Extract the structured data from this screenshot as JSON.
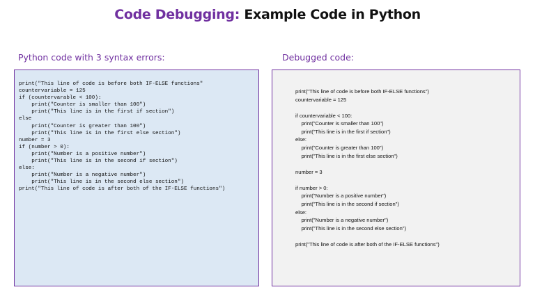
{
  "header": {
    "title_accent": "Code Debugging:",
    "title_rest": " Example Code in Python"
  },
  "left_pane": {
    "label": "Python code with 3 syntax errors:",
    "code": "print(\"This line of code is before both IF-ELSE functions\"\ncountervariable = 125\nif (countervarable < 100):\n    print(\"Counter is smaller than 100\")\n    print(\"This line is in the first if section\")\nelse\n    print(\"Counter is greater than 100\")\n    print(\"This line is in the first else section\")\nnumber = 3\nif (number > 0):\n    print(\"Number is a positive number\")\n    print(\"This line is in the second if section\")\nelse:\n    print(\"Number is a negative number\")\n    print(\"This line is in the second else section\")\nprint(\"This line of code is after both of the IF-ELSE functions\")"
  },
  "right_pane": {
    "label": "Debugged code:",
    "lines": [
      "print(\"This line of code is before both IF-ELSE functions\")",
      "countervariable = 125",
      "",
      "if countervariable < 100:",
      "    print(\"Counter is smaller than 100\")",
      "    print(\"This line is in the first if section\")",
      "else:",
      "    print(\"Counter is greater than 100\")",
      "    print(\"This line is in the first else section\")",
      "",
      "number = 3",
      "",
      "if number > 0:",
      "    print(\"Number is a positive number\")",
      "    print(\"This line is in the second if section\")",
      "else:",
      "    print(\"Number is a negative number\")",
      "    print(\"This line is in the second else section\")",
      "",
      "print(\"This line of code is after both of the IF-ELSE functions\")"
    ]
  },
  "colors": {
    "accent": "#7030a0",
    "left_pane_bg": "#dce8f4",
    "right_pane_bg": "#f2f2f2"
  }
}
